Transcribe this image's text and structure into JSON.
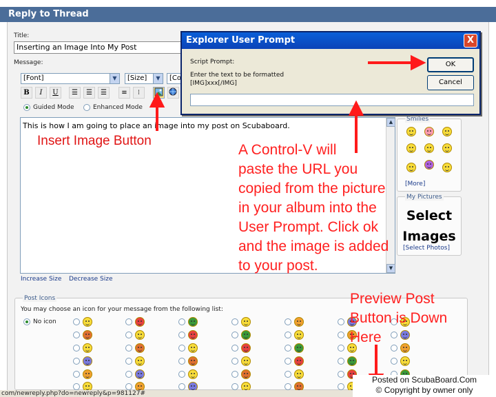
{
  "header": {
    "title": "Reply to Thread"
  },
  "form": {
    "title_label": "Title:",
    "title_value": "Inserting an Image Into My Post",
    "message_label": "Message:",
    "font_select": "[Font]",
    "size_select": "[Size]",
    "color_select": "[Co",
    "bold": "B",
    "italic": "I",
    "underline": "U",
    "guided_mode": "Guided Mode",
    "enhanced_mode": "Enhanced Mode",
    "message_text": "This is how I am going to place an image into my post on Scubaboard.",
    "increase_size": "Increase Size",
    "decrease_size": "Decrease Size"
  },
  "smilies": {
    "legend": "Smilies",
    "more": "[More]",
    "count": 9
  },
  "pictures": {
    "legend": "My Pictures",
    "select_line1": "Select",
    "select_line2": "Images",
    "select_photos": "[Select Photos]"
  },
  "post_icons": {
    "legend": "Post Icons",
    "instructions": "You may choose an icon for your message from the following list:",
    "no_icon": "No icon"
  },
  "dialog": {
    "title": "Explorer User Prompt",
    "close": "X",
    "script_prompt": "Script Prompt:",
    "line1": "Enter the text to be formatted",
    "line2": "[IMG]xxx[/IMG]",
    "ok": "OK",
    "cancel": "Cancel"
  },
  "annotations": {
    "insert_image": "Insert Image Button",
    "control_v": [
      "A Control-V will",
      "paste the URL you",
      "copied from the picture",
      "in your album into the",
      "User Prompt.  Click ok",
      "and the image is added",
      "to your post."
    ],
    "preview": [
      "Preview Post",
      "Button is Down",
      "Here"
    ]
  },
  "status_bar": {
    "url": "com/newreply.php?do=newreply&p=981127#"
  },
  "watermark": {
    "line1": "Posted on ScubaBoard.Com",
    "line2": "© Copyright by owner only"
  },
  "colors": {
    "header": "#4b6d99",
    "dialog_title": "#0b43b8",
    "annotation": "#ff2020"
  }
}
